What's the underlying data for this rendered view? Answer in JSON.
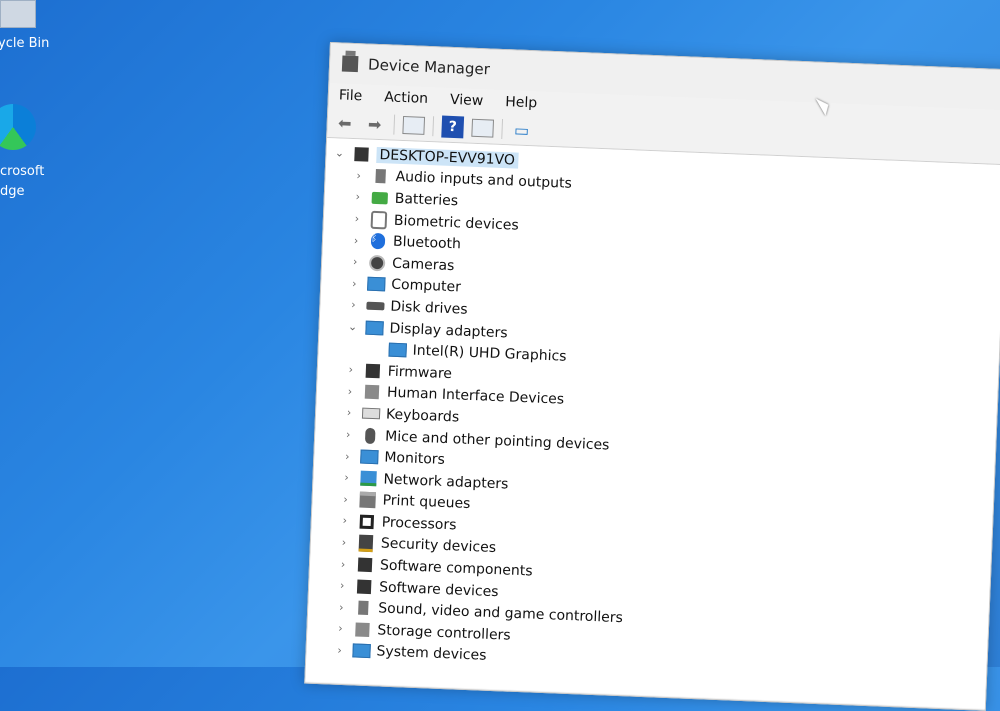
{
  "desktop": {
    "recycle_bin_label": "ycle Bin",
    "edge_label_line1": "crosoft",
    "edge_label_line2": "dge"
  },
  "window": {
    "title": "Device Manager",
    "menu": [
      "File",
      "Action",
      "View",
      "Help"
    ]
  },
  "toolbar": {
    "buttons": [
      {
        "name": "back",
        "icon": "arrow-left-icon"
      },
      {
        "name": "forward",
        "icon": "arrow-right-icon"
      },
      {
        "name": "show-hide",
        "icon": "panel-icon"
      },
      {
        "name": "help",
        "icon": "help-icon",
        "glyph": "?"
      },
      {
        "name": "properties",
        "icon": "properties-icon"
      },
      {
        "name": "scan",
        "icon": "monitor-scan-icon"
      }
    ]
  },
  "tree": {
    "root": "DESKTOP-EVV91VO",
    "items": [
      {
        "label": "Audio inputs and outputs",
        "icon": "speaker-icon",
        "expanded": false
      },
      {
        "label": "Batteries",
        "icon": "battery-icon",
        "expanded": false
      },
      {
        "label": "Biometric devices",
        "icon": "fingerprint-icon",
        "expanded": false
      },
      {
        "label": "Bluetooth",
        "icon": "bluetooth-icon",
        "expanded": false
      },
      {
        "label": "Cameras",
        "icon": "camera-icon",
        "expanded": false
      },
      {
        "label": "Computer",
        "icon": "computer-icon",
        "expanded": false
      },
      {
        "label": "Disk drives",
        "icon": "disk-icon",
        "expanded": false
      },
      {
        "label": "Display adapters",
        "icon": "display-adapter-icon",
        "expanded": true,
        "children": [
          {
            "label": "Intel(R) UHD Graphics",
            "icon": "display-adapter-icon"
          }
        ]
      },
      {
        "label": "Firmware",
        "icon": "firmware-icon",
        "expanded": false
      },
      {
        "label": "Human Interface Devices",
        "icon": "hid-icon",
        "expanded": false
      },
      {
        "label": "Keyboards",
        "icon": "keyboard-icon",
        "expanded": false
      },
      {
        "label": "Mice and other pointing devices",
        "icon": "mouse-icon",
        "expanded": false
      },
      {
        "label": "Monitors",
        "icon": "monitor-icon",
        "expanded": false
      },
      {
        "label": "Network adapters",
        "icon": "network-icon",
        "expanded": false
      },
      {
        "label": "Print queues",
        "icon": "printer-icon",
        "expanded": false
      },
      {
        "label": "Processors",
        "icon": "processor-icon",
        "expanded": false
      },
      {
        "label": "Security devices",
        "icon": "security-key-icon",
        "expanded": false
      },
      {
        "label": "Software components",
        "icon": "software-component-icon",
        "expanded": false
      },
      {
        "label": "Software devices",
        "icon": "software-device-icon",
        "expanded": false
      },
      {
        "label": "Sound, video and game controllers",
        "icon": "speaker-icon",
        "expanded": false
      },
      {
        "label": "Storage controllers",
        "icon": "storage-icon",
        "expanded": false
      },
      {
        "label": "System devices",
        "icon": "system-icon",
        "expanded": false
      }
    ]
  }
}
